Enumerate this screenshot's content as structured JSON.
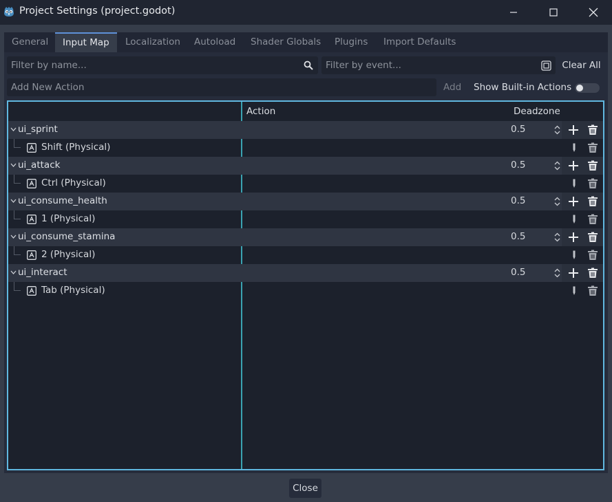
{
  "window": {
    "title": "Project Settings (project.godot)",
    "icons": [
      "godot-logo-icon",
      "minimize-icon",
      "maximize-icon",
      "close-icon"
    ]
  },
  "tabs": [
    {
      "label": "General",
      "active": false
    },
    {
      "label": "Input Map",
      "active": true
    },
    {
      "label": "Localization",
      "active": false
    },
    {
      "label": "Autoload",
      "active": false
    },
    {
      "label": "Shader Globals",
      "active": false
    },
    {
      "label": "Plugins",
      "active": false
    },
    {
      "label": "Import Defaults",
      "active": false
    }
  ],
  "filters": {
    "name_placeholder": "Filter by name...",
    "event_placeholder": "Filter by event...",
    "clear_all_label": "Clear All"
  },
  "add_action": {
    "placeholder": "Add New Action",
    "add_label": "Add",
    "show_builtin_label": "Show Built-in Actions",
    "show_builtin_enabled": false
  },
  "table": {
    "headers": {
      "action": "Action",
      "deadzone": "Deadzone"
    },
    "actions": [
      {
        "name": "ui_sprint",
        "deadzone": "0.5",
        "events": [
          "Shift (Physical)"
        ]
      },
      {
        "name": "ui_attack",
        "deadzone": "0.5",
        "events": [
          "Ctrl (Physical)"
        ]
      },
      {
        "name": "ui_consume_health",
        "deadzone": "0.5",
        "events": [
          "1 (Physical)"
        ]
      },
      {
        "name": "ui_consume_stamina",
        "deadzone": "0.5",
        "events": [
          "2 (Physical)"
        ]
      },
      {
        "name": "ui_interact",
        "deadzone": "0.5",
        "events": [
          "Tab (Physical)"
        ]
      }
    ]
  },
  "footer": {
    "close_label": "Close"
  },
  "colors": {
    "accent": "#5e91d9",
    "focus_border": "#60b8e0",
    "background": "#363d4a"
  }
}
